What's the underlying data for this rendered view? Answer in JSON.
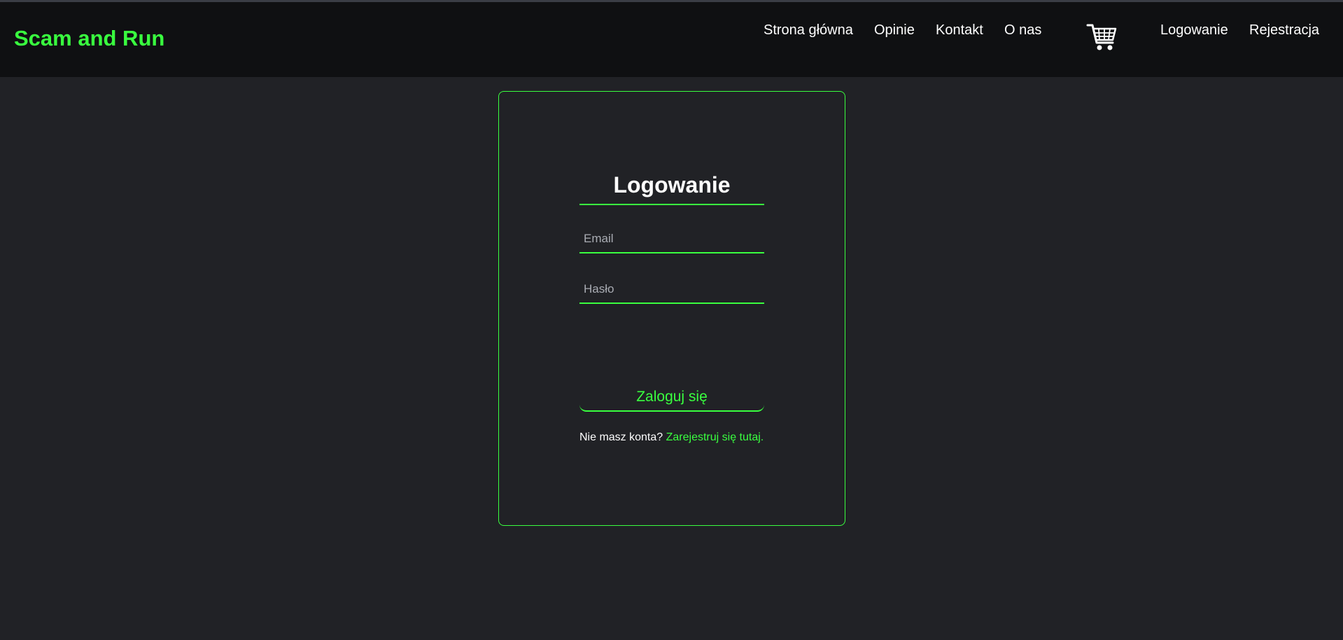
{
  "header": {
    "brand": "Scam and Run",
    "nav": [
      {
        "label": "Strona główna"
      },
      {
        "label": "Opinie"
      },
      {
        "label": "Kontakt"
      },
      {
        "label": "O nas"
      }
    ],
    "cart_icon": "shopping-cart-icon",
    "auth": [
      {
        "label": "Logowanie"
      },
      {
        "label": "Rejestracja"
      }
    ]
  },
  "login_form": {
    "title": "Logowanie",
    "email": {
      "placeholder": "Email",
      "value": ""
    },
    "password": {
      "placeholder": "Hasło",
      "value": ""
    },
    "submit_label": "Zaloguj się",
    "register_prompt": "Nie masz konta? ",
    "register_link": "Zarejestruj się tutaj",
    "register_suffix": "."
  },
  "colors": {
    "accent": "#39ff3f",
    "background": "#212226",
    "navbar": "#0f1012",
    "text": "#ffffff"
  }
}
